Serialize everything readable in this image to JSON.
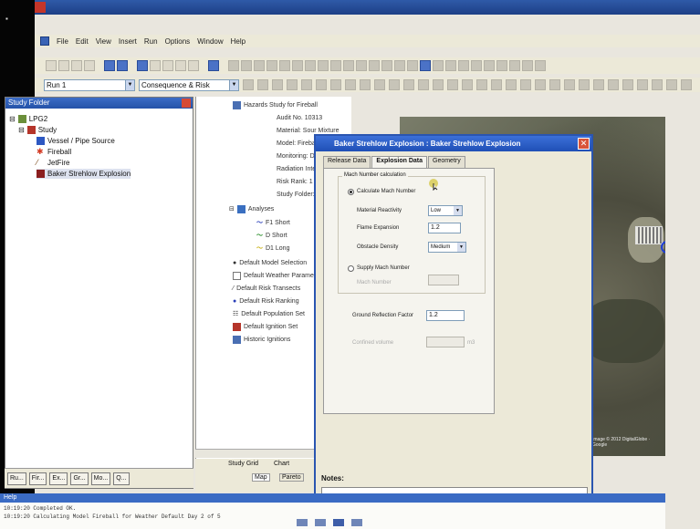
{
  "app": {
    "menu": [
      "File",
      "Edit",
      "View",
      "Insert",
      "Run",
      "Options",
      "Window",
      "Help"
    ]
  },
  "toolbar2": {
    "run_combo": "Run 1",
    "view_combo": "Consequence & Risk"
  },
  "study_folder": {
    "title": "Study Folder",
    "items": [
      {
        "label": "LPG2"
      },
      {
        "label": "Study"
      },
      {
        "label": "Vessel / Pipe Source"
      },
      {
        "label": "Fireball"
      },
      {
        "label": "JetFire"
      },
      {
        "label": "Baker Strehlow Explosion"
      }
    ],
    "bottom_tabs": [
      "Ru...",
      "Fir...",
      "Ex...",
      "Gr...",
      "Mo...",
      "Q..."
    ]
  },
  "middle_tree": {
    "rows": [
      "Hazards Study for Fireball",
      "Audit No. 10313",
      "Material: Sour Mixture",
      "Model: Fireball",
      "Monitoring: DNV",
      "Radiation Intensity",
      "Risk Rank: 1",
      "Study Folder: LPG",
      "Analyses",
      "F1 Short",
      "D Short",
      "D1 Long",
      "Default Model Selection",
      "Default Weather Parameters",
      "Default Risk Transects",
      "Default Risk Ranking",
      "Default Population Set",
      "Default Ignition Set",
      "Historic Ignitions"
    ],
    "tabs": [
      "Study Grid",
      "Chart",
      "Map",
      "Pareto"
    ]
  },
  "dialog": {
    "title": "Baker Strehlow Explosion : Baker Strehlow Explosion",
    "tabs": [
      "Release Data",
      "Explosion Data",
      "Geometry"
    ],
    "active_tab": "Explosion Data",
    "group_title": "Mach Number calculation",
    "calc_option": "Calculate Mach Number",
    "fields": {
      "reactivity_label": "Material Reactivity",
      "reactivity_value": "Low",
      "flame_expansion_label": "Flame Expansion",
      "flame_expansion_value": "1.2",
      "obstacle_density_label": "Obstacle Density",
      "obstacle_density_value": "Medium"
    },
    "supply_option": "Supply Mach Number",
    "mach_number_label": "Mach Number",
    "ground_reflection_label": "Ground Reflection Factor",
    "ground_reflection_value": "1.2",
    "bottom_field_label": "Confined volume",
    "bottom_field_unit": "m3",
    "notes_label": "Notes:"
  },
  "map": {
    "caption": "Image © 2012 DigitalGlobe · Google"
  },
  "status": {
    "strip": "Help",
    "console_lines": [
      "10:19:20  Completed OK.",
      "10:19:20  Calculating Model Fireball for Weather Default Day 2 of 5"
    ]
  },
  "colors": {
    "title_blue": "#1f4fb6",
    "panel_bg": "#ece9d8",
    "close_red": "#d8543a"
  }
}
